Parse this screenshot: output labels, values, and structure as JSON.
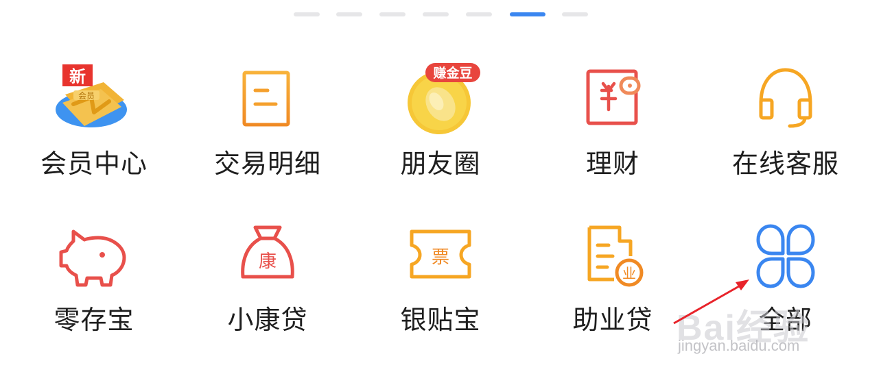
{
  "pager": {
    "count": 7,
    "active_index": 5
  },
  "grid": {
    "row1": [
      {
        "label": "会员中心",
        "icon": "member-gold-card-icon",
        "badge": "新",
        "badge2": "会员"
      },
      {
        "label": "交易明细",
        "icon": "transaction-document-icon"
      },
      {
        "label": "朋友圈",
        "icon": "gold-bean-coin-icon",
        "badge": "赚金豆"
      },
      {
        "label": "理财",
        "icon": "wallet-yuan-icon"
      },
      {
        "label": "在线客服",
        "icon": "headset-icon"
      }
    ],
    "row2": [
      {
        "label": "零存宝",
        "icon": "piggy-bank-icon"
      },
      {
        "label": "小康贷",
        "icon": "money-bag-icon",
        "glyph": "康"
      },
      {
        "label": "银贴宝",
        "icon": "ticket-icon",
        "glyph": "票"
      },
      {
        "label": "助业贷",
        "icon": "business-document-icon",
        "glyph": "业"
      },
      {
        "label": "全部",
        "icon": "all-apps-grid-icon"
      }
    ]
  },
  "watermark": {
    "text": "Bai经验",
    "sub": "jingyan.baidu.com"
  },
  "colors": {
    "accent": "#3a86f0",
    "orange": "#f6a623",
    "red": "#e8504b"
  }
}
